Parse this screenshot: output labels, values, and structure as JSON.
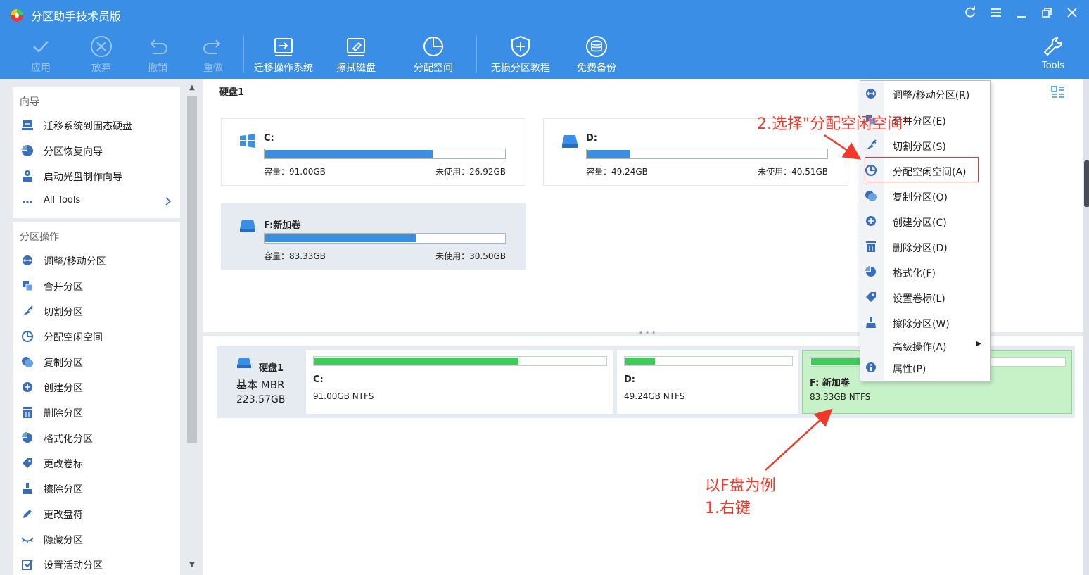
{
  "window": {
    "title": "分区助手技术员版",
    "buttons": [
      "refresh-icon",
      "menu-icon",
      "minimize-icon",
      "restore-icon",
      "close-icon"
    ]
  },
  "toolbar": {
    "apply": "应用",
    "discard": "放弃",
    "undo": "撤销",
    "redo": "重做",
    "migrate_os": "迁移操作系统",
    "wipe_disk": "擦拭磁盘",
    "allocate_space": "分配空间",
    "lossless_tutorial": "无损分区教程",
    "free_backup": "免费备份",
    "tools": "Tools"
  },
  "sidebar": {
    "wizard_title": "向导",
    "wizard_items": [
      {
        "label": "迁移系统到固态硬盘",
        "icon": "migrate-ssd-icon"
      },
      {
        "label": "分区恢复向导",
        "icon": "partition-recovery-icon"
      },
      {
        "label": "启动光盘制作向导",
        "icon": "boot-disc-icon"
      },
      {
        "label": "All Tools",
        "icon": "more-icon"
      }
    ],
    "ops_title": "分区操作",
    "ops_items": [
      {
        "label": "调整/移动分区",
        "icon": "resize-icon"
      },
      {
        "label": "合并分区",
        "icon": "merge-icon"
      },
      {
        "label": "切割分区",
        "icon": "split-icon"
      },
      {
        "label": "分配空闲空间",
        "icon": "allocate-icon"
      },
      {
        "label": "复制分区",
        "icon": "copy-icon"
      },
      {
        "label": "创建分区",
        "icon": "create-icon"
      },
      {
        "label": "删除分区",
        "icon": "delete-icon"
      },
      {
        "label": "格式化分区",
        "icon": "format-icon"
      },
      {
        "label": "更改卷标",
        "icon": "label-icon"
      },
      {
        "label": "擦除分区",
        "icon": "wipe-icon"
      },
      {
        "label": "更改盘符",
        "icon": "drive-letter-icon"
      },
      {
        "label": "隐藏分区",
        "icon": "hide-icon"
      },
      {
        "label": "设置活动分区",
        "icon": "set-active-icon"
      }
    ]
  },
  "main": {
    "disk_title": "硬盘1",
    "partitions": [
      {
        "name": "C:",
        "capacity": "容量：91.00GB",
        "free": "未使用：26.92GB",
        "used_fraction": 0.7,
        "icon": "windows-drive-icon"
      },
      {
        "name": "D:",
        "capacity": "容量：49.24GB",
        "free": "未使用：40.51GB",
        "used_fraction": 0.18,
        "icon": "drive-icon"
      },
      {
        "name": "F:新加卷",
        "capacity": "容量：83.33GB",
        "free": "未使用：30.50GB",
        "used_fraction": 0.63,
        "icon": "drive-icon"
      }
    ],
    "disk_map": {
      "name": "硬盘1",
      "type": "基本 MBR",
      "size": "223.57GB",
      "parts": [
        {
          "name": "C:",
          "fs": "91.00GB NTFS",
          "used_fraction": 0.7
        },
        {
          "name": "D:",
          "fs": "49.24GB NTFS",
          "used_fraction": 0.18
        },
        {
          "name": "F: 新加卷",
          "fs": "83.33GB NTFS",
          "used_fraction": 0.63
        }
      ]
    }
  },
  "context_menu": {
    "items": [
      {
        "label": "调整/移动分区(R)",
        "icon": "resize-icon"
      },
      {
        "label": "合并分区(E)",
        "icon": "merge-icon"
      },
      {
        "label": "切割分区(S)",
        "icon": "split-icon"
      },
      {
        "label": "分配空闲空间(A)",
        "icon": "allocate-icon"
      },
      {
        "label": "复制分区(O)",
        "icon": "copy-icon"
      },
      {
        "label": "创建分区(C)",
        "icon": "create-icon"
      },
      {
        "label": "删除分区(D)",
        "icon": "delete-icon"
      },
      {
        "label": "格式化(F)",
        "icon": "format-icon"
      },
      {
        "label": "设置卷标(L)",
        "icon": "label-icon"
      },
      {
        "label": "擦除分区(W)",
        "icon": "wipe-icon"
      },
      {
        "label": "高级操作(A)",
        "icon": ""
      },
      {
        "label": "属性(P)",
        "icon": "info-icon"
      }
    ]
  },
  "annotations": {
    "step2": "2.选择\"分配空闲空间\"",
    "example": "以F盘为例",
    "step1": "1.右键"
  },
  "colors": {
    "accent": "#3a8ee6",
    "bar_blue": "#3a8ee6",
    "bar_green": "#3ecb5a",
    "selected_green": "#c7f2c8",
    "annotation_red": "#f0392b"
  }
}
